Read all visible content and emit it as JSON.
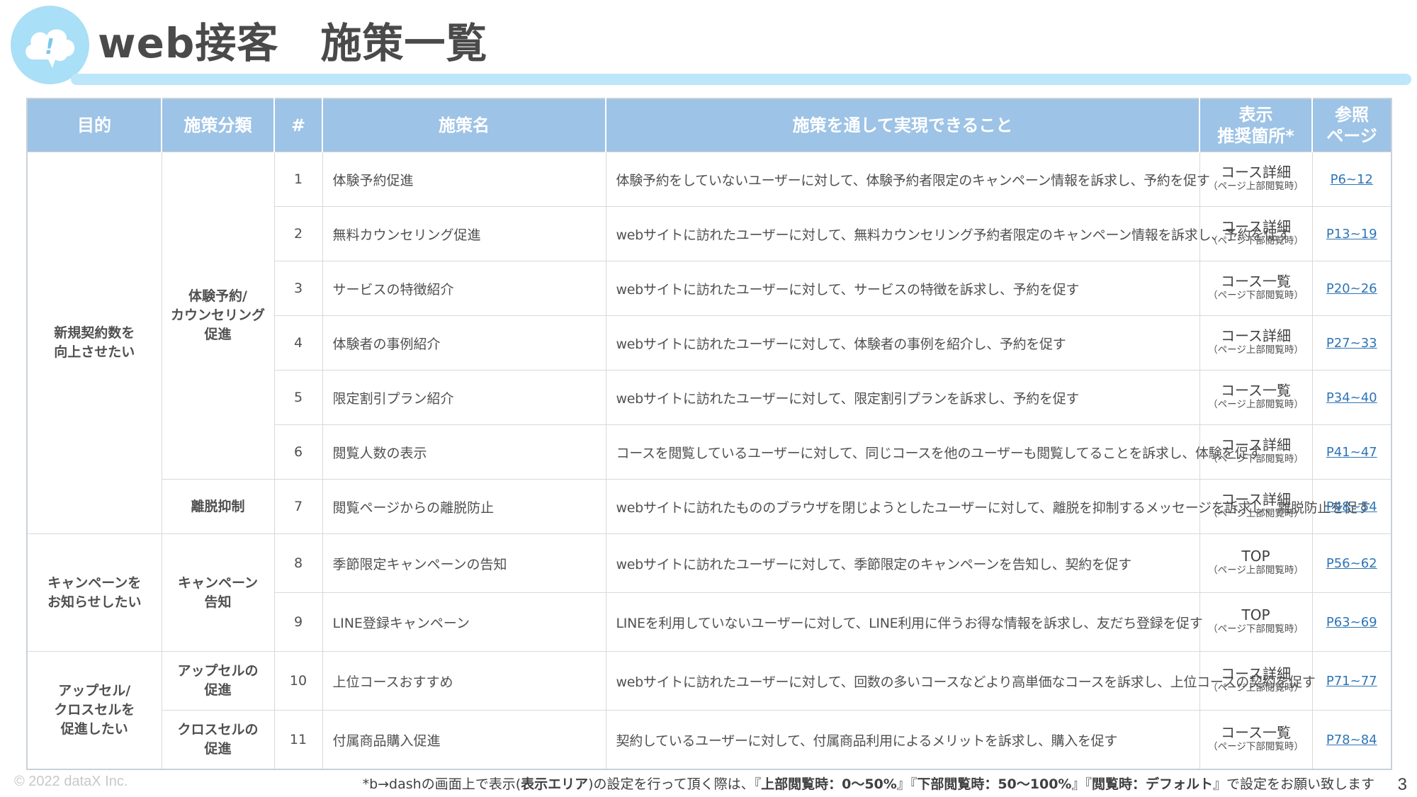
{
  "header": {
    "title": "web接客　施策一覧"
  },
  "colors": {
    "header_bg": "#9dc3e6",
    "accent_light": "#bde6fa",
    "link": "#2e75b6"
  },
  "icons": {
    "logo": "cloud-exclamation-icon"
  },
  "table": {
    "headers": {
      "purpose": "目的",
      "category": "施策分類",
      "number": "#",
      "name": "施策名",
      "description": "施策を通して実現できること",
      "position": "表示\n推奨箇所*",
      "reference": "参照\nページ"
    },
    "purposes": {
      "g1": "新規契約数を\n向上させたい",
      "g2": "キャンペーンを\nお知らせしたい",
      "g3": "アップセル/\nクロスセルを\n促進したい"
    },
    "categories": {
      "c1": "体験予約/\nカウンセリング\n促進",
      "c2": "離脱抑制",
      "c3": "キャンペーン\n告知",
      "c4": "アップセルの\n促進",
      "c5": "クロスセルの\n促進"
    },
    "rows": [
      {
        "num": "1",
        "name": "体験予約促進",
        "desc": "体験予約をしていないユーザーに対して、体験予約者限定のキャンペーン情報を訴求し、予約を促す",
        "pos": "コース詳細",
        "pos_sub": "（ページ上部閲覧時）",
        "ref": "P6~12"
      },
      {
        "num": "2",
        "name": "無料カウンセリング促進",
        "desc": "webサイトに訪れたユーザーに対して、無料カウンセリング予約者限定のキャンペーン情報を訴求し、予約を促す",
        "pos": "コース詳細",
        "pos_sub": "（ページ下部閲覧時）",
        "ref": "P13~19"
      },
      {
        "num": "3",
        "name": "サービスの特徴紹介",
        "desc": "webサイトに訪れたユーザーに対して、サービスの特徴を訴求し、予約を促す",
        "pos": "コース一覧",
        "pos_sub": "（ページ下部閲覧時）",
        "ref": "P20~26"
      },
      {
        "num": "4",
        "name": "体験者の事例紹介",
        "desc": "webサイトに訪れたユーザーに対して、体験者の事例を紹介し、予約を促す",
        "pos": "コース詳細",
        "pos_sub": "（ページ上部閲覧時）",
        "ref": "P27~33"
      },
      {
        "num": "5",
        "name": "限定割引プラン紹介",
        "desc": "webサイトに訪れたユーザーに対して、限定割引プランを訴求し、予約を促す",
        "pos": "コース一覧",
        "pos_sub": "（ページ上部閲覧時）",
        "ref": "P34~40"
      },
      {
        "num": "6",
        "name": "閲覧人数の表示",
        "desc": "コースを閲覧しているユーザーに対して、同じコースを他のユーザーも閲覧してることを訴求し、体験を促す",
        "pos": "コース詳細",
        "pos_sub": "（ページ下部閲覧時）",
        "ref": "P41~47"
      },
      {
        "num": "7",
        "name": "閲覧ページからの離脱防止",
        "desc": "webサイトに訪れたもののブラウザを閉じようとしたユーザーに対して、離脱を抑制するメッセージを訴求し、離脱防止を促す",
        "pos": "コース詳細",
        "pos_sub": "（ページ上部閲覧時）",
        "ref": "P48~54"
      },
      {
        "num": "8",
        "name": "季節限定キャンペーンの告知",
        "desc": "webサイトに訪れたユーザーに対して、季節限定のキャンペーンを告知し、契約を促す",
        "pos": "TOP",
        "pos_sub": "（ページ上部閲覧時）",
        "ref": "P56~62"
      },
      {
        "num": "9",
        "name": "LINE登録キャンペーン",
        "desc": "LINEを利用していないユーザーに対して、LINE利用に伴うお得な情報を訴求し、友だち登録を促す",
        "pos": "TOP",
        "pos_sub": "（ページ下部閲覧時）",
        "ref": "P63~69"
      },
      {
        "num": "10",
        "name": "上位コースおすすめ",
        "desc": "webサイトに訪れたユーザーに対して、回数の多いコースなどより高単価なコースを訴求し、上位コースの契約を促す",
        "pos": "コース詳細",
        "pos_sub": "（ページ上部閲覧時）",
        "ref": "P71~77"
      },
      {
        "num": "11",
        "name": "付属商品購入促進",
        "desc": "契約しているユーザーに対して、付属商品利用によるメリットを訴求し、購入を促す",
        "pos": "コース一覧",
        "pos_sub": "（ページ下部閲覧時）",
        "ref": "P78~84"
      }
    ]
  },
  "footer": {
    "copyright": "© 2022 dataX Inc.",
    "note_prefix": "*b→dashの画面上で表示(",
    "note_bold1": "表示エリア",
    "note_mid": ")の設定を行って頂く際は、『",
    "note_bold2": "上部閲覧時：0～50%",
    "note_sep1": "』『",
    "note_bold3": "下部閲覧時：50～100%",
    "note_sep2": "』『",
    "note_bold4": "閲覧時：デフォルト",
    "note_suffix": "』で設定をお願い致します",
    "page_number": "3"
  }
}
